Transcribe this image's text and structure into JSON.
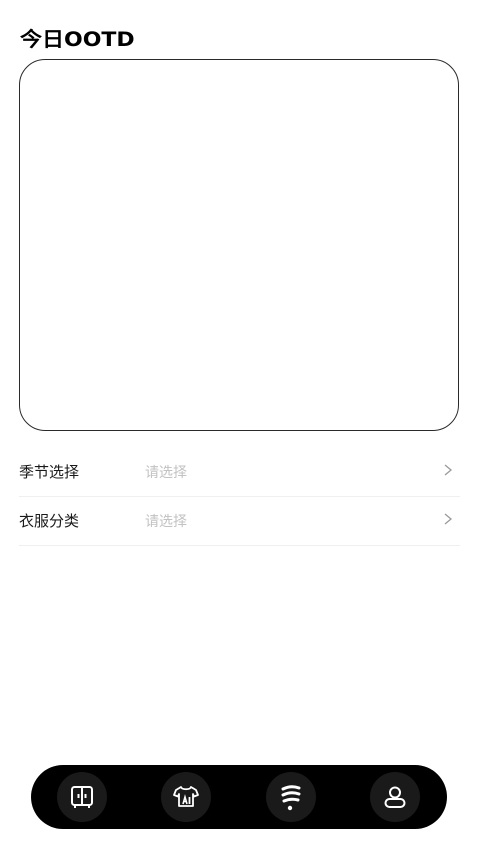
{
  "header": {
    "title": "今日OOTD"
  },
  "form": {
    "rows": [
      {
        "label": "季节选择",
        "placeholder": "请选择"
      },
      {
        "label": "衣服分类",
        "placeholder": "请选择"
      }
    ]
  },
  "tabbar": {
    "tabs": [
      {
        "icon": "wardrobe-icon"
      },
      {
        "icon": "ai-clothes-icon"
      },
      {
        "icon": "outfit-icon"
      },
      {
        "icon": "profile-icon"
      }
    ]
  },
  "colors": {
    "tabbar_background": "#000000",
    "tab_background": "#1a1a1a",
    "placeholder_text": "#c2c2c2",
    "divider": "#efefef"
  }
}
